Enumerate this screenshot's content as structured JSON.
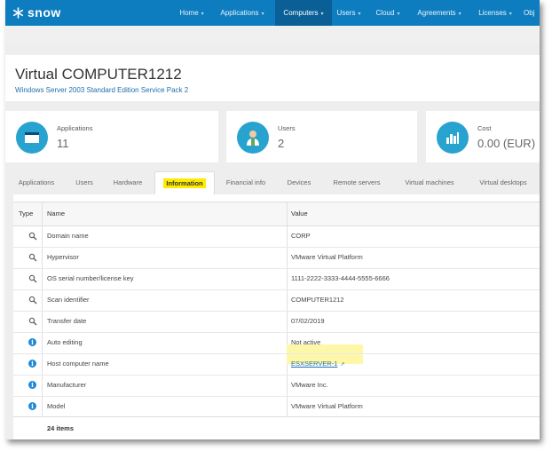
{
  "app": {
    "logo_text": "snow"
  },
  "nav": [
    {
      "label": "Home",
      "active": false
    },
    {
      "label": "Applications",
      "active": false
    },
    {
      "label": "Computers",
      "active": true
    },
    {
      "label": "Users",
      "active": false
    },
    {
      "label": "Cloud",
      "active": false
    },
    {
      "label": "Agreements",
      "active": false
    },
    {
      "label": "Licenses",
      "active": false
    },
    {
      "label": "Obj",
      "active": false
    }
  ],
  "page": {
    "title": "Virtual COMPUTER1212",
    "subtitle": "Windows Server 2003 Standard Edition Service Pack 2"
  },
  "stats": [
    {
      "label": "Applications",
      "value": "11",
      "icon": "window-icon"
    },
    {
      "label": "Users",
      "value": "2",
      "icon": "user-icon"
    },
    {
      "label": "Cost",
      "value": "0.00 (EUR)",
      "icon": "cost-chart-icon"
    }
  ],
  "tabs": [
    {
      "label": "Applications",
      "active": false
    },
    {
      "label": "Users",
      "active": false
    },
    {
      "label": "Hardware",
      "active": false
    },
    {
      "label": "Information",
      "active": true
    },
    {
      "label": "Financial info",
      "active": false
    },
    {
      "label": "Devices",
      "active": false
    },
    {
      "label": "Remote servers",
      "active": false
    },
    {
      "label": "Virtual machines",
      "active": false
    },
    {
      "label": "Virtual desktops",
      "active": false
    }
  ],
  "table": {
    "headers": {
      "type": "Type",
      "name": "Name",
      "value": "Value"
    },
    "rows": [
      {
        "type": "search-icon",
        "name": "Domain name",
        "value": "CORP"
      },
      {
        "type": "search-icon",
        "name": "Hypervisor",
        "value": "VMware Virtual Platform"
      },
      {
        "type": "search-icon",
        "name": "OS serial number/license key",
        "value": "1111-2222-3333-4444-5555-6666"
      },
      {
        "type": "search-icon",
        "name": "Scan identifier",
        "value": "COMPUTER1212"
      },
      {
        "type": "search-icon",
        "name": "Transfer date",
        "value": "07/02/2019"
      },
      {
        "type": "info-icon",
        "name": "Auto editing",
        "value": "Not active"
      },
      {
        "type": "info-icon",
        "name": "Host computer name",
        "value": "ESXSERVER-1",
        "link": true
      },
      {
        "type": "info-icon",
        "name": "Manufacturer",
        "value": "VMware Inc."
      },
      {
        "type": "info-icon",
        "name": "Model",
        "value": "VMware Virtual Platform"
      }
    ],
    "footer": "24 items"
  },
  "colors": {
    "brand": "#0e7dbf",
    "accent": "#28a3d0",
    "highlight": "#ffeb00"
  }
}
